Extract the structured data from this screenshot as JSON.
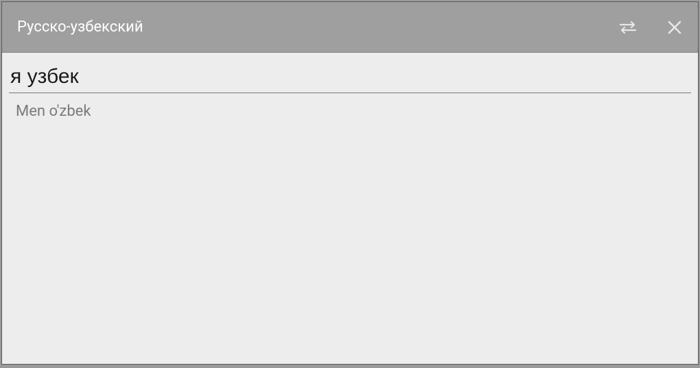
{
  "header": {
    "title": "Русско-узбекский"
  },
  "translation": {
    "source_text": "я узбек",
    "target_text": "Men o'zbek"
  }
}
